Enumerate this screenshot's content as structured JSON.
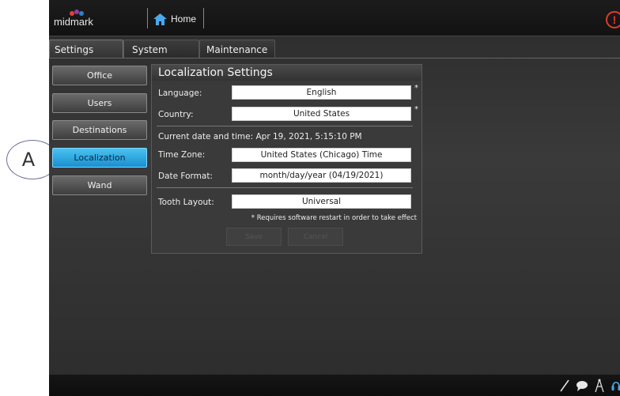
{
  "callout": {
    "label": "A"
  },
  "header": {
    "logo_text": "midmark",
    "home_label": "Home",
    "alert_symbol": "!"
  },
  "tabs": [
    {
      "label": "Settings",
      "active": true
    },
    {
      "label": "System",
      "active": false
    },
    {
      "label": "Maintenance",
      "active": false
    }
  ],
  "sidebar": {
    "items": [
      {
        "label": "Office",
        "selected": false
      },
      {
        "label": "Users",
        "selected": false
      },
      {
        "label": "Destinations",
        "selected": false
      },
      {
        "label": "Localization",
        "selected": true
      },
      {
        "label": "Wand",
        "selected": false
      }
    ]
  },
  "panel": {
    "title": "Localization Settings",
    "language": {
      "label": "Language:",
      "value": "English",
      "required_mark": "*"
    },
    "country": {
      "label": "Country:",
      "value": "United States",
      "required_mark": "*"
    },
    "current_datetime": "Current date and time: Apr 19, 2021, 5:15:10 PM",
    "time_zone": {
      "label": "Time Zone:",
      "value": "United States (Chicago) Time"
    },
    "date_format": {
      "label": "Date Format:",
      "value": "month/day/year (04/19/2021)"
    },
    "tooth_layout": {
      "label": "Tooth Layout:",
      "value": "Universal"
    },
    "restart_note": "* Requires software restart in order to take effect",
    "save_label": "Save",
    "cancel_label": "Cancel"
  },
  "status_icons": [
    "pen-icon",
    "chat-bubble-icon",
    "antenna-icon",
    "headset-icon",
    "battery-icon"
  ],
  "colors": {
    "accent_selected": "#2aa6e4",
    "alert": "#e23a2a",
    "logo_dots": [
      "#e0413a",
      "#8a3fa0",
      "#2e7fd0"
    ]
  }
}
